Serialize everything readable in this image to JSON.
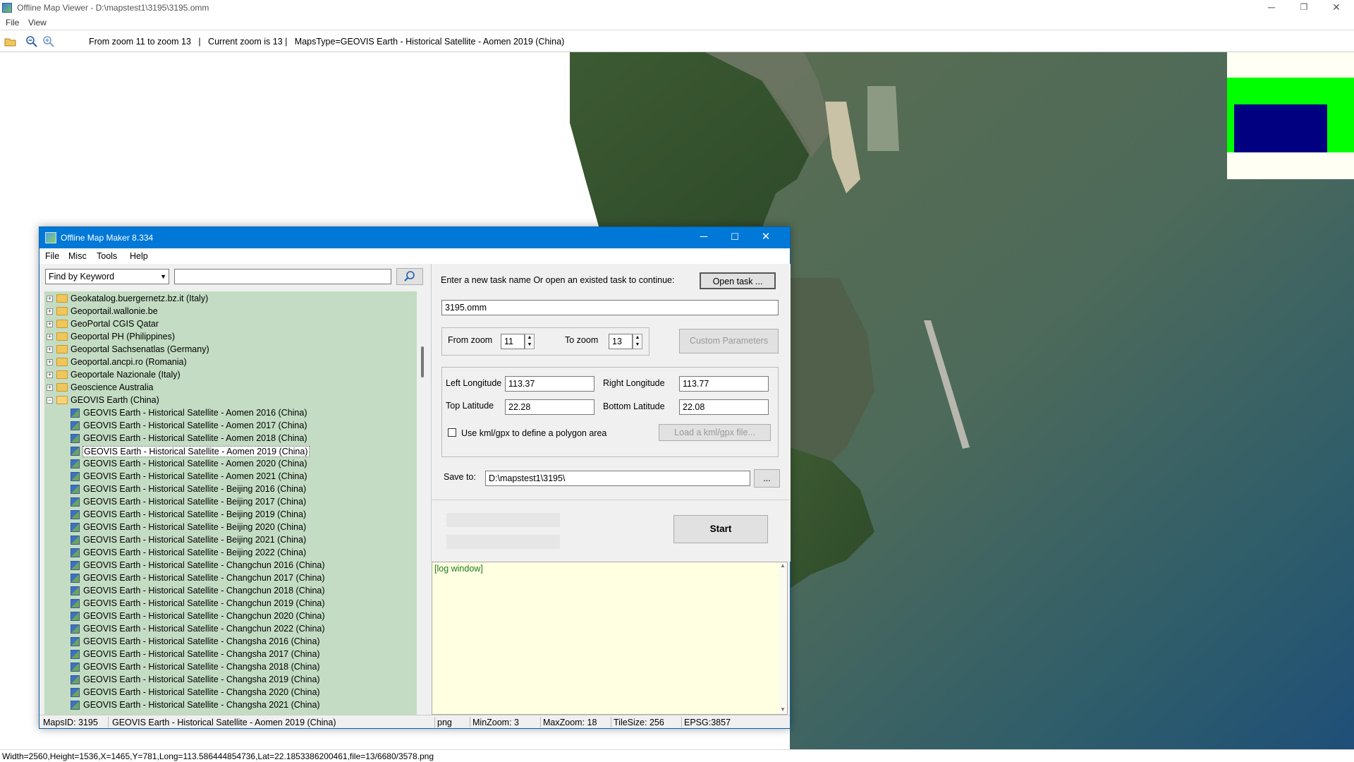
{
  "app": {
    "title": "Offline Map Viewer - D:\\mapstest1\\3195\\3195.omm",
    "menu": [
      "File",
      "View"
    ],
    "toolbar_info": "From zoom 11 to zoom 13   |   Current zoom is 13 |   MapsType=GEOVIS Earth - Historical Satellite - Aomen 2019 (China)",
    "status": "Width=2560,Height=1536,X=1465,Y=781,Long=113.586444854736,Lat=22.1853386200461,file=13/6680/3578.png",
    "window_controls": [
      "─",
      "❐",
      "✕"
    ]
  },
  "maker": {
    "title": "Offline Map Maker 8.334",
    "menu": [
      "File",
      "Misc",
      "Tools",
      "Help"
    ],
    "window_controls": [
      "─",
      "☐",
      "✕"
    ],
    "search": {
      "mode": "Find by Keyword",
      "keyword": ""
    },
    "tree": {
      "folders": [
        "Geokatalog.buergernetz.bz.it (Italy)",
        "Geoportail.wallonie.be",
        "GeoPortal CGIS Qatar",
        "Geoportal PH (Philippines)",
        "Geoportal Sachsenatlas (Germany)",
        "Geoportal.ancpi.ro (Romania)",
        "Geoportale Nazionale (Italy)",
        "Geoscience Australia"
      ],
      "open_folder": "GEOVIS Earth (China)",
      "items": [
        "GEOVIS Earth - Historical Satellite - Aomen 2016 (China)",
        "GEOVIS Earth - Historical Satellite - Aomen 2017 (China)",
        "GEOVIS Earth - Historical Satellite - Aomen 2018 (China)",
        "GEOVIS Earth - Historical Satellite - Aomen 2019 (China)",
        "GEOVIS Earth - Historical Satellite - Aomen 2020 (China)",
        "GEOVIS Earth - Historical Satellite - Aomen 2021 (China)",
        "GEOVIS Earth - Historical Satellite - Beijing 2016 (China)",
        "GEOVIS Earth - Historical Satellite - Beijing 2017 (China)",
        "GEOVIS Earth - Historical Satellite - Beijing 2019 (China)",
        "GEOVIS Earth - Historical Satellite - Beijing 2020 (China)",
        "GEOVIS Earth - Historical Satellite - Beijing 2021 (China)",
        "GEOVIS Earth - Historical Satellite - Beijing 2022 (China)",
        "GEOVIS Earth - Historical Satellite - Changchun 2016 (China)",
        "GEOVIS Earth - Historical Satellite - Changchun 2017 (China)",
        "GEOVIS Earth - Historical Satellite - Changchun 2018 (China)",
        "GEOVIS Earth - Historical Satellite - Changchun 2019 (China)",
        "GEOVIS Earth - Historical Satellite - Changchun 2020 (China)",
        "GEOVIS Earth - Historical Satellite - Changchun 2022 (China)",
        "GEOVIS Earth - Historical Satellite - Changsha 2016 (China)",
        "GEOVIS Earth - Historical Satellite - Changsha 2017 (China)",
        "GEOVIS Earth - Historical Satellite - Changsha 2018 (China)",
        "GEOVIS Earth - Historical Satellite - Changsha 2019 (China)",
        "GEOVIS Earth - Historical Satellite - Changsha 2020 (China)",
        "GEOVIS Earth - Historical Satellite - Changsha 2021 (China)"
      ],
      "selected": "GEOVIS Earth - Historical Satellite - Aomen 2019 (China)"
    },
    "task_prompt": "Enter a new task name Or open an existed task to continue:",
    "open_task": "Open task ...",
    "task_name": "3195.omm",
    "from_zoom_label": "From zoom",
    "from_zoom": "11",
    "to_zoom_label": "To zoom",
    "to_zoom": "13",
    "custom_params": "Custom Parameters",
    "left_lon_label": "Left Longitude",
    "left_lon": "113.37",
    "right_lon_label": "Right Longitude",
    "right_lon": "113.77",
    "top_lat_label": "Top Latitude",
    "top_lat": "22.28",
    "bottom_lat_label": "Bottom Latitude",
    "bottom_lat": "22.08",
    "kml_label": "Use kml/gpx to define a polygon area",
    "kml_button": "Load a kml/gpx file...",
    "save_label": "Save to:",
    "save_path": "D:\\mapstest1\\3195\\",
    "browse": "...",
    "start": "Start",
    "log": "[log window]",
    "status": {
      "maps_id": "MapsID: 3195",
      "name": "GEOVIS Earth - Historical Satellite - Aomen 2019 (China)",
      "format": "png",
      "min_zoom": "MinZoom: 3",
      "max_zoom": "MaxZoom: 18",
      "tile_size": "TileSize: 256",
      "epsg": "EPSG:3857"
    }
  },
  "colors": {
    "accent": "#0078d7",
    "tree_bg": "#c3dcc3",
    "log_bg": "#ffffe1",
    "log_text": "#1e7d1e",
    "sea": "#4a6a55"
  }
}
